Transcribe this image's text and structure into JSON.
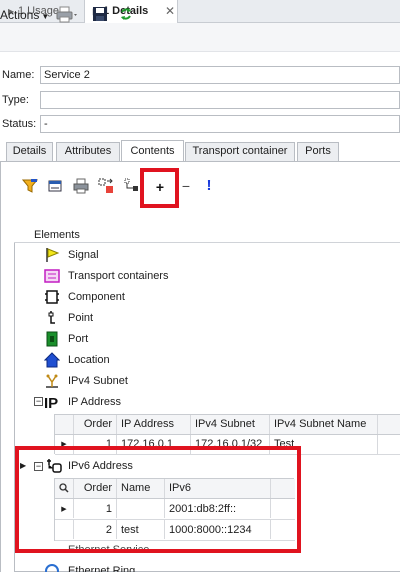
{
  "tabs": [
    {
      "label": "1 Usage"
    },
    {
      "label": "1 Details"
    }
  ],
  "toolbar": {
    "actions_label": "Actions"
  },
  "form": {
    "name_label": "Name:",
    "name_value": "Service 2",
    "type_label": "Type:",
    "type_value": "",
    "status_label": "Status:",
    "status_value": "-"
  },
  "content_tabs": [
    {
      "label": "Details"
    },
    {
      "label": "Attributes"
    },
    {
      "label": "Contents"
    },
    {
      "label": "Transport container"
    },
    {
      "label": "Ports"
    }
  ],
  "contents_toolbar": {
    "add_label": "+",
    "remove_label": "−",
    "info_label": "!"
  },
  "tree": {
    "header": "Elements",
    "items": [
      {
        "label": "Signal",
        "icon": "signal-flag-icon"
      },
      {
        "label": "Transport containers",
        "icon": "transport-container-icon"
      },
      {
        "label": "Component",
        "icon": "component-icon"
      },
      {
        "label": "Point",
        "icon": "point-icon"
      },
      {
        "label": "Port",
        "icon": "port-icon"
      },
      {
        "label": "Location",
        "icon": "location-icon"
      },
      {
        "label": "IPv4 Subnet",
        "icon": "ipv4-subnet-icon"
      },
      {
        "label": "IP Address",
        "icon": "ip-address-icon"
      },
      {
        "label": "IPv6 Address",
        "icon": "ipv6-address-icon"
      },
      {
        "label": "Ethernet Service",
        "icon": "ethernet-service-icon"
      },
      {
        "label": "Ethernet Ring",
        "icon": "ethernet-ring-icon"
      }
    ],
    "expander_expanded": "−"
  },
  "ip_grid": {
    "columns": [
      "Order",
      "IP Address",
      "IPv4 Subnet",
      "IPv4 Subnet Name"
    ],
    "rows": [
      {
        "order": "1",
        "ip": "172.16.0.1",
        "subnet": "172.16.0.1/32",
        "subnet_name": "Test"
      }
    ]
  },
  "ipv6_grid": {
    "columns": [
      "Order",
      "Name",
      "IPv6"
    ],
    "rows": [
      {
        "order": "1",
        "name": "",
        "ipv6": "2001:db8:2ff::"
      },
      {
        "order": "2",
        "name": "test",
        "ipv6": "1000:8000::1234"
      }
    ]
  },
  "colors": {
    "highlight": "#e0131f",
    "accent_blue": "#1a3bdc"
  }
}
